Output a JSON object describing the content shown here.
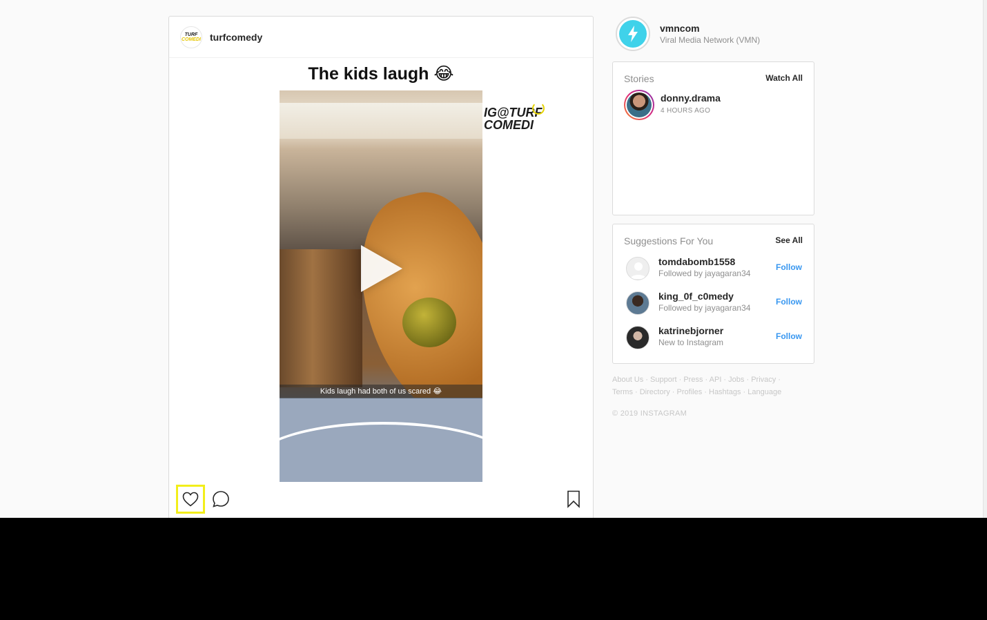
{
  "post": {
    "username": "turfcomedy",
    "avatar_text_top": "TURF",
    "avatar_text_bottom": "COMEDI",
    "media_caption": "The kids laugh 😂",
    "video_overlay_text": "Kids laugh had both of us scared 😂",
    "watermark_line1": "IG@TURF",
    "watermark_line2": "COMEDI",
    "actions": {
      "like": "heart-icon",
      "comment": "comment-icon",
      "save": "bookmark-icon"
    }
  },
  "profile": {
    "username": "vmncom",
    "full_name": "Viral Media Network (VMN)"
  },
  "stories": {
    "heading": "Stories",
    "link": "Watch All",
    "items": [
      {
        "username": "donny.drama",
        "time": "4 HOURS AGO"
      }
    ]
  },
  "suggestions": {
    "heading": "Suggestions For You",
    "link": "See All",
    "items": [
      {
        "username": "tomdabomb1558",
        "subtitle": "Followed by jayagaran34",
        "action": "Follow"
      },
      {
        "username": "king_0f_c0medy",
        "subtitle": "Followed by jayagaran34",
        "action": "Follow"
      },
      {
        "username": "katrinebjorner",
        "subtitle": "New to Instagram",
        "action": "Follow"
      }
    ]
  },
  "footer": {
    "links": [
      "About Us",
      "Support",
      "Press",
      "API",
      "Jobs",
      "Privacy",
      "Terms",
      "Directory",
      "Profiles",
      "Hashtags",
      "Language"
    ],
    "copyright": "© 2019 INSTAGRAM"
  },
  "colors": {
    "accent": "#3897f0",
    "highlight": "#f2ee1a"
  }
}
